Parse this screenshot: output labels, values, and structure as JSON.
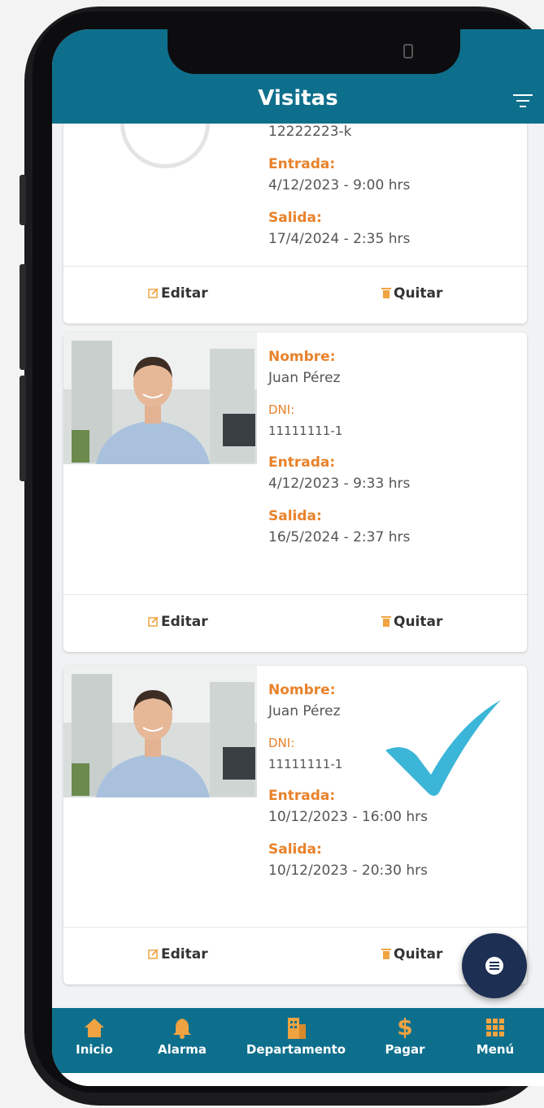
{
  "header": {
    "title": "Visitas"
  },
  "cards": [
    {
      "dni": "12222223-k",
      "entrada_label": "Entrada:",
      "entrada": "4/12/2023 - 9:00 hrs",
      "salida_label": "Salida:",
      "salida": "17/4/2024 - 2:35 hrs"
    },
    {
      "nombre_label": "Nombre:",
      "nombre": "Juan Pérez",
      "dni_label": "DNI:",
      "dni": "11111111-1",
      "entrada_label": "Entrada:",
      "entrada": "4/12/2023 - 9:33 hrs",
      "salida_label": "Salida:",
      "salida": "16/5/2024 - 2:37 hrs"
    },
    {
      "nombre_label": "Nombre:",
      "nombre": "Juan Pérez",
      "dni_label": "DNI:",
      "dni": "11111111-1",
      "entrada_label": "Entrada:",
      "entrada": "10/12/2023 - 16:00 hrs",
      "salida_label": "Salida:",
      "salida": "10/12/2023 - 20:30 hrs",
      "verified": true
    }
  ],
  "actions": {
    "edit": "Editar",
    "remove": "Quitar"
  },
  "nav": [
    {
      "label": "Inicio",
      "icon": "home-icon"
    },
    {
      "label": "Alarma",
      "icon": "bell-icon"
    },
    {
      "label": "Departamento",
      "icon": "building-icon"
    },
    {
      "label": "Pagar",
      "icon": "dollar-icon"
    },
    {
      "label": "Menú",
      "icon": "grid-icon"
    }
  ],
  "colors": {
    "primary": "#0e6f8c",
    "accent": "#e8822b",
    "check": "#3bb6d8",
    "fab": "#1d2f52"
  }
}
